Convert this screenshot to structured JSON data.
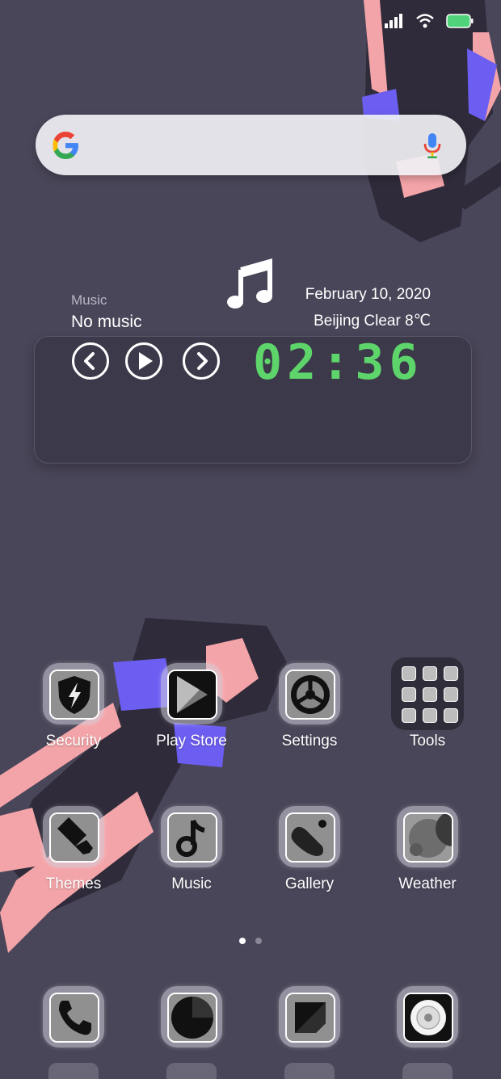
{
  "search": {
    "logo": "google-g-icon",
    "voice": "mic-icon"
  },
  "widget": {
    "music_title": "Music",
    "music_status": "No music",
    "date": "February  10, 2020",
    "weather": "Beijing  Clear  8℃",
    "clock": "02:36",
    "clock_color": "#5dd56a"
  },
  "apps": [
    {
      "label": "Security",
      "icon": "shield-bolt-icon"
    },
    {
      "label": "Play Store",
      "icon": "play-store-icon"
    },
    {
      "label": "Settings",
      "icon": "gear-icon"
    },
    {
      "label": "Tools",
      "icon": "folder-icon"
    },
    {
      "label": "Themes",
      "icon": "paint-brush-icon"
    },
    {
      "label": "Music",
      "icon": "music-note-icon"
    },
    {
      "label": "Gallery",
      "icon": "gallery-icon"
    },
    {
      "label": "Weather",
      "icon": "weather-icon"
    }
  ],
  "dock": [
    {
      "icon": "phone-icon"
    },
    {
      "icon": "messages-icon"
    },
    {
      "icon": "notes-icon"
    },
    {
      "icon": "camera-icon"
    }
  ],
  "pager": {
    "pages": 2,
    "active": 1
  },
  "colors": {
    "background": "#4a4659",
    "battery": "#4fd37a",
    "accent_clock": "#5dd56a"
  }
}
